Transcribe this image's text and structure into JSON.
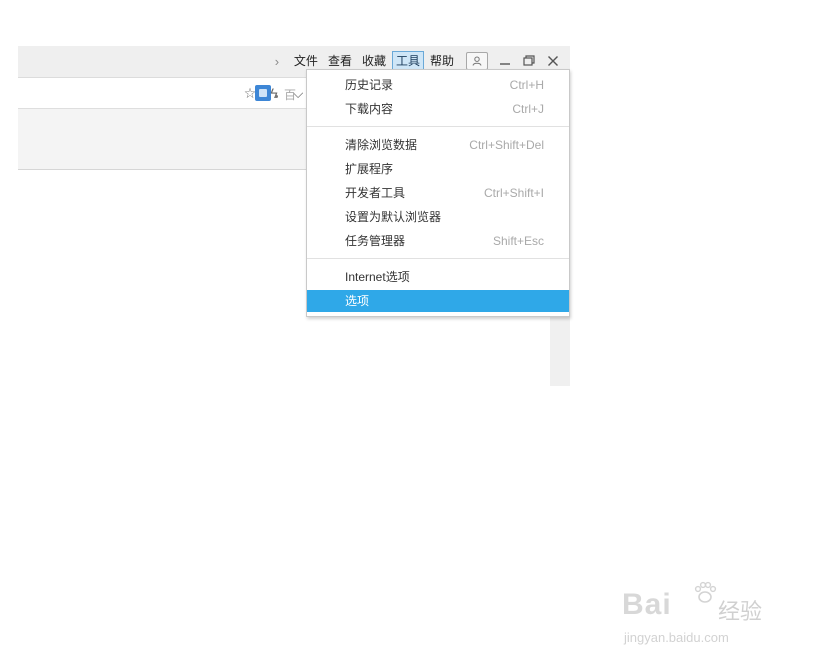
{
  "menubar": {
    "items": [
      "文件",
      "查看",
      "收藏",
      "工具",
      "帮助"
    ],
    "active": "工具"
  },
  "addressbar": {
    "search_placeholder": "百"
  },
  "dropdown": {
    "groups": [
      [
        {
          "label": "历史记录",
          "shortcut": "Ctrl+H"
        },
        {
          "label": "下载内容",
          "shortcut": "Ctrl+J"
        }
      ],
      [
        {
          "label": "清除浏览数据",
          "shortcut": "Ctrl+Shift+Del"
        },
        {
          "label": "扩展程序",
          "shortcut": ""
        },
        {
          "label": "开发者工具",
          "shortcut": "Ctrl+Shift+I"
        },
        {
          "label": "设置为默认浏览器",
          "shortcut": ""
        },
        {
          "label": "任务管理器",
          "shortcut": "Shift+Esc"
        }
      ],
      [
        {
          "label": "Internet选项",
          "shortcut": ""
        },
        {
          "label": "选项",
          "shortcut": "",
          "highlighted": true
        }
      ]
    ]
  },
  "watermark": {
    "logo": "Bai",
    "logo_suffix": "经验",
    "url": "jingyan.baidu.com"
  },
  "colors": {
    "highlight": "#2fa8e8",
    "active_menu_bg": "#cfe6f7"
  }
}
